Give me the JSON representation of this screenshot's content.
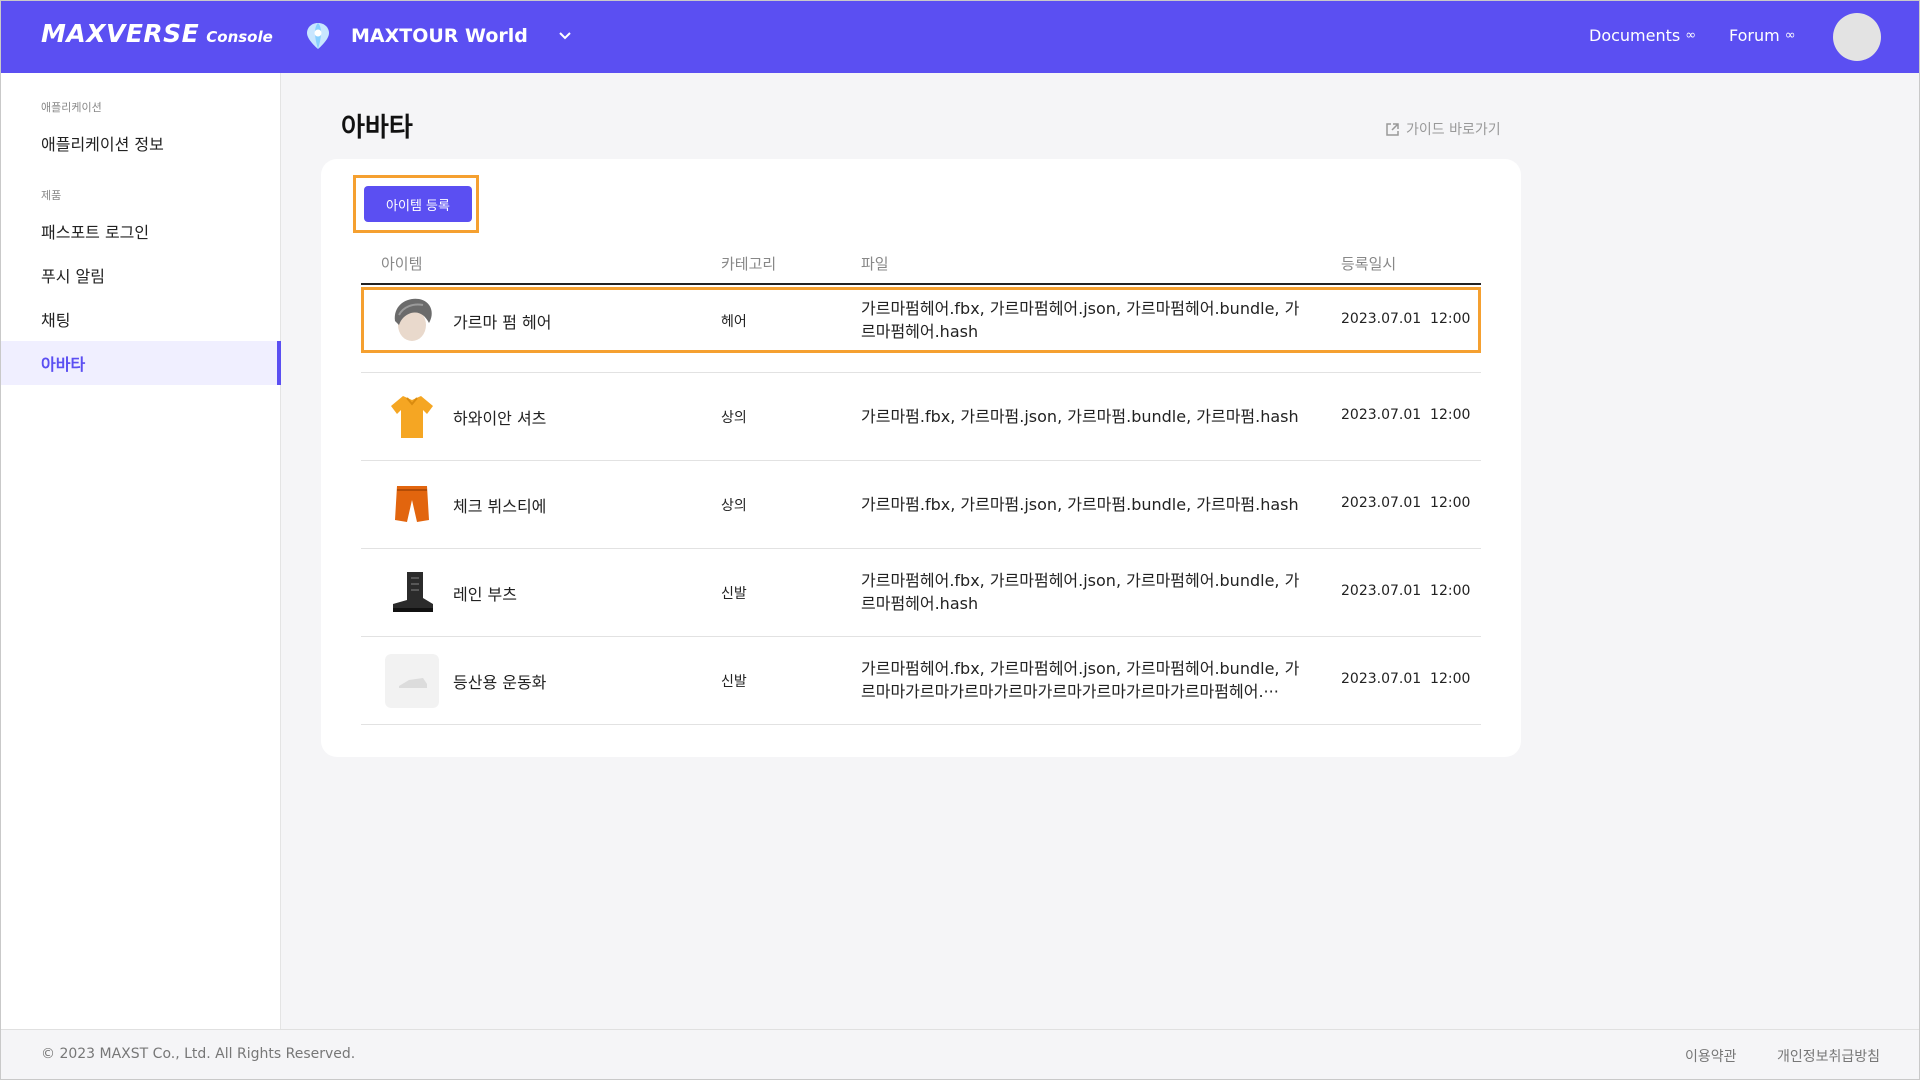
{
  "header": {
    "logo_main": "MAXVERSE",
    "logo_sub": "Console",
    "project": "MAXTOUR World",
    "links": [
      {
        "label": "Documents",
        "icon": "external-link-icon"
      },
      {
        "label": "Forum",
        "icon": "external-link-icon"
      }
    ],
    "brand_color": "#5b4ff2"
  },
  "sidebar": {
    "section_app": "애플리케이션",
    "app_info": "애플리케이션 정보",
    "section_product": "제품",
    "items": [
      {
        "label": "패스포트 로그인",
        "active": false
      },
      {
        "label": "푸시 알림",
        "active": false
      },
      {
        "label": "채팅",
        "active": false
      },
      {
        "label": "아바타",
        "active": true
      }
    ]
  },
  "main": {
    "title": "아바타",
    "guide_link": "가이드 바로가기",
    "add_button": "아이템 등록",
    "columns": [
      "아이템",
      "카테고리",
      "파일",
      "등록일시"
    ],
    "rows": [
      {
        "name": "가르마 펌 헤어",
        "category": "헤어",
        "files": "가르마펌헤어.fbx, 가르마펌헤어.json, 가르마펌헤어.bundle, 가르마펌헤어.hash",
        "date": "2023.07.01  12:00",
        "thumb": "hair-icon",
        "highlighted": true
      },
      {
        "name": "하와이안 셔츠",
        "category": "상의",
        "files": "가르마펌.fbx, 가르마펌.json, 가르마펌.bundle, 가르마펌.hash",
        "date": "2023.07.01  12:00",
        "thumb": "shirt-icon",
        "highlighted": false
      },
      {
        "name": "체크 뷔스티에",
        "category": "상의",
        "files": "가르마펌.fbx, 가르마펌.json, 가르마펌.bundle, 가르마펌.hash",
        "date": "2023.07.01  12:00",
        "thumb": "shorts-icon",
        "highlighted": false
      },
      {
        "name": "레인 부츠",
        "category": "신발",
        "files": "가르마펌헤어.fbx, 가르마펌헤어.json, 가르마펌헤어.bundle, 가르마펌헤어.hash",
        "date": "2023.07.01  12:00",
        "thumb": "boot-icon",
        "highlighted": false
      },
      {
        "name": "등산용 운동화",
        "category": "신발",
        "files": "가르마펌헤어.fbx, 가르마펌헤어.json, 가르마펌헤어.bundle, 가르마마가르마가르마가르마가르마가르마가르마가르마펌헤어.···",
        "date": "2023.07.01  12:00",
        "thumb": "sneaker-placeholder-icon",
        "highlighted": false
      }
    ]
  },
  "footer": {
    "copyright": "© 2023 MAXST Co., Ltd. All Rights Reserved.",
    "terms": "이용약관",
    "privacy": "개인정보취급방침"
  }
}
